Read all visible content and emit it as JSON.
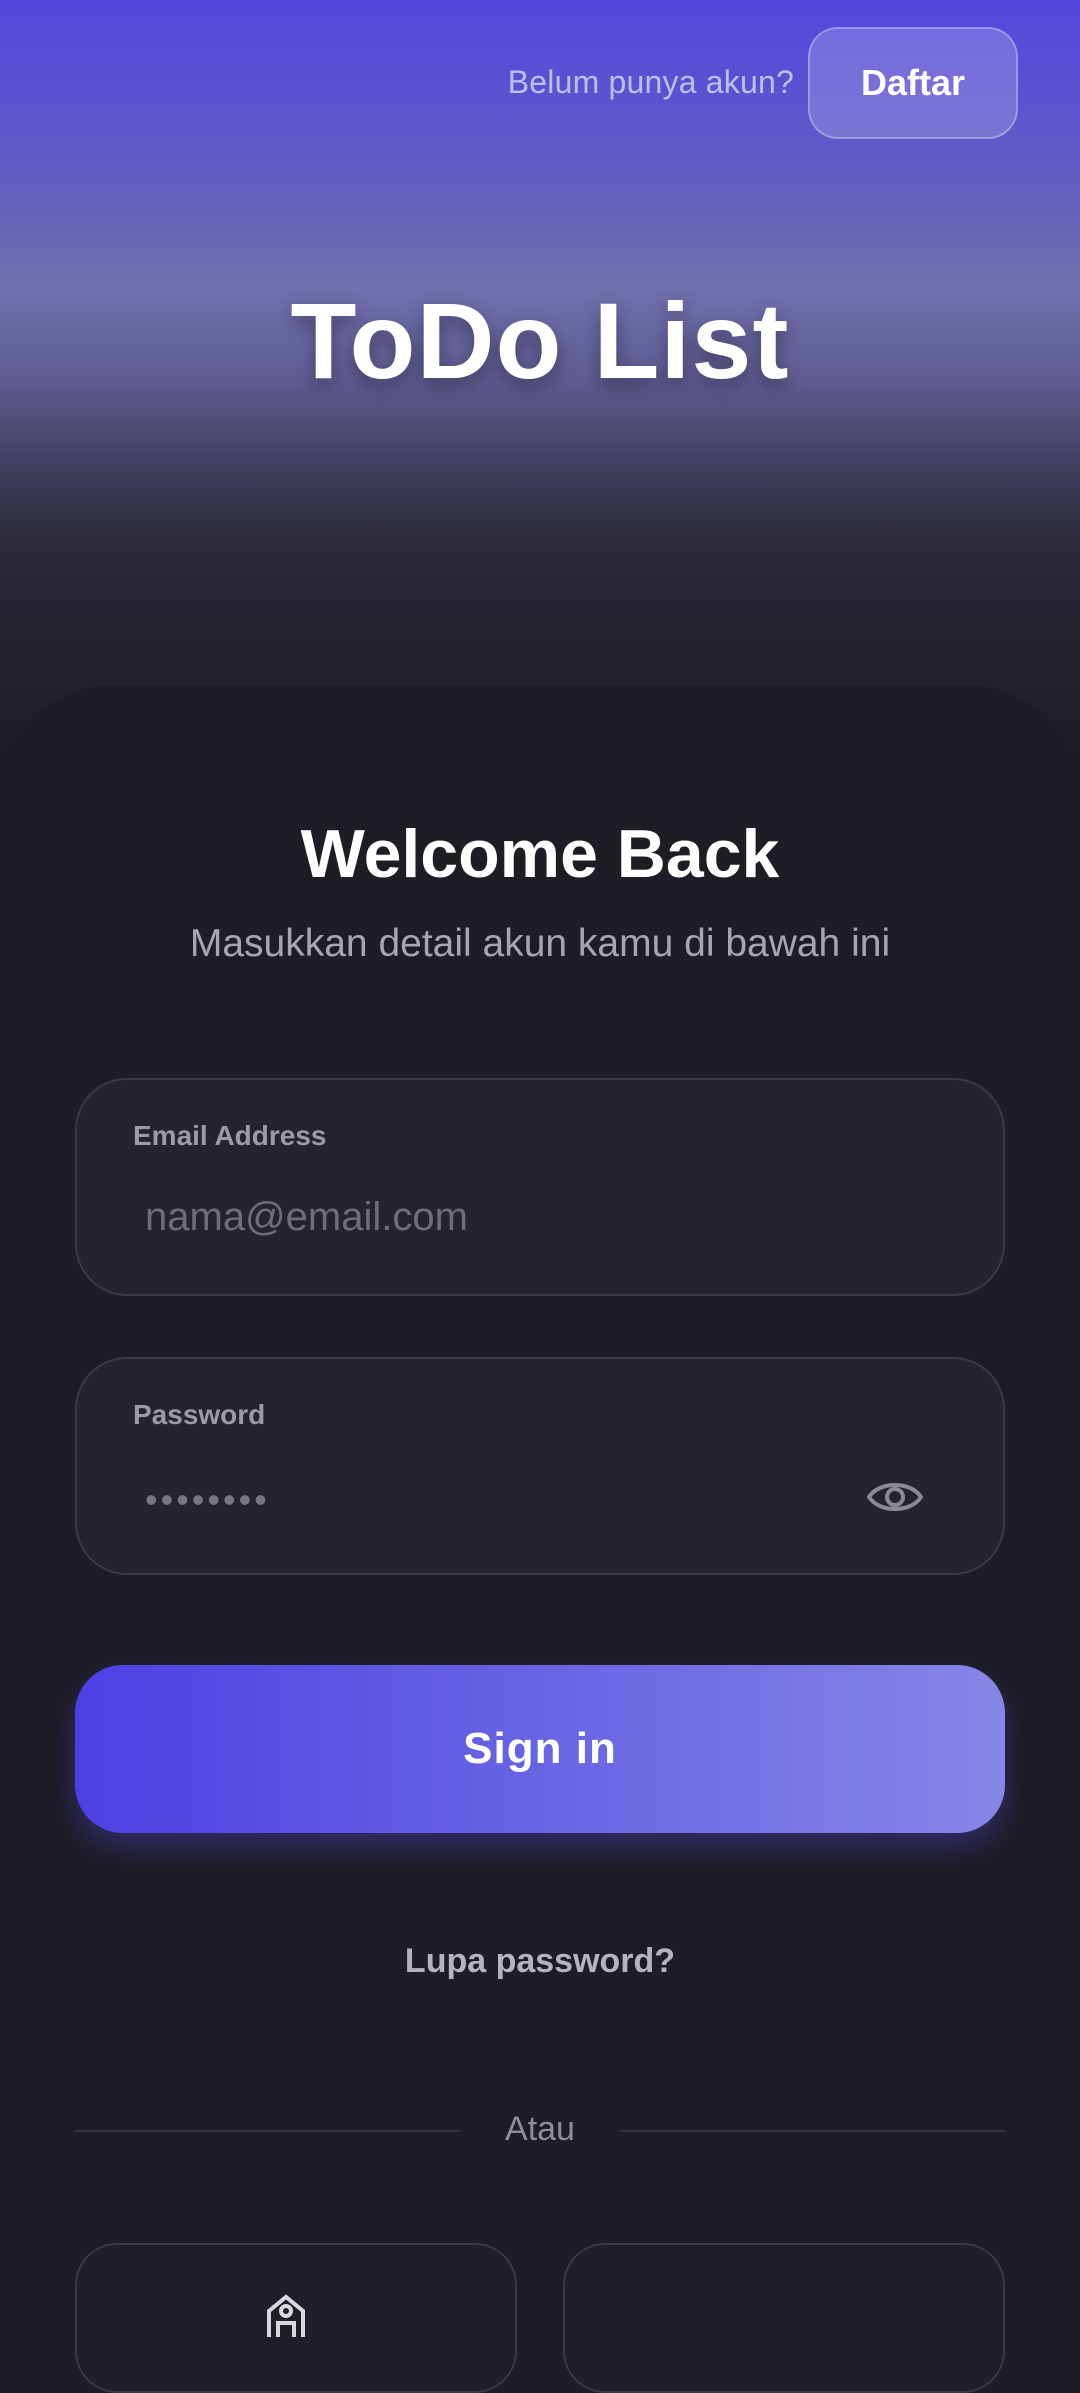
{
  "header": {
    "prompt": "Belum punya akun?",
    "register_label": "Daftar"
  },
  "app_title": "ToDo List",
  "login": {
    "heading": "Welcome Back",
    "subtitle": "Masukkan detail akun kamu di bawah ini",
    "email": {
      "label": "Email Address",
      "placeholder": "nama@email.com"
    },
    "password": {
      "label": "Password",
      "masked_value": "••••••••"
    },
    "signin_label": "Sign in",
    "forgot_label": "Lupa password?",
    "divider_label": "Atau"
  },
  "colors": {
    "accent": "#5546de",
    "card_bg": "#1d1d25",
    "field_bg": "#24242d"
  }
}
